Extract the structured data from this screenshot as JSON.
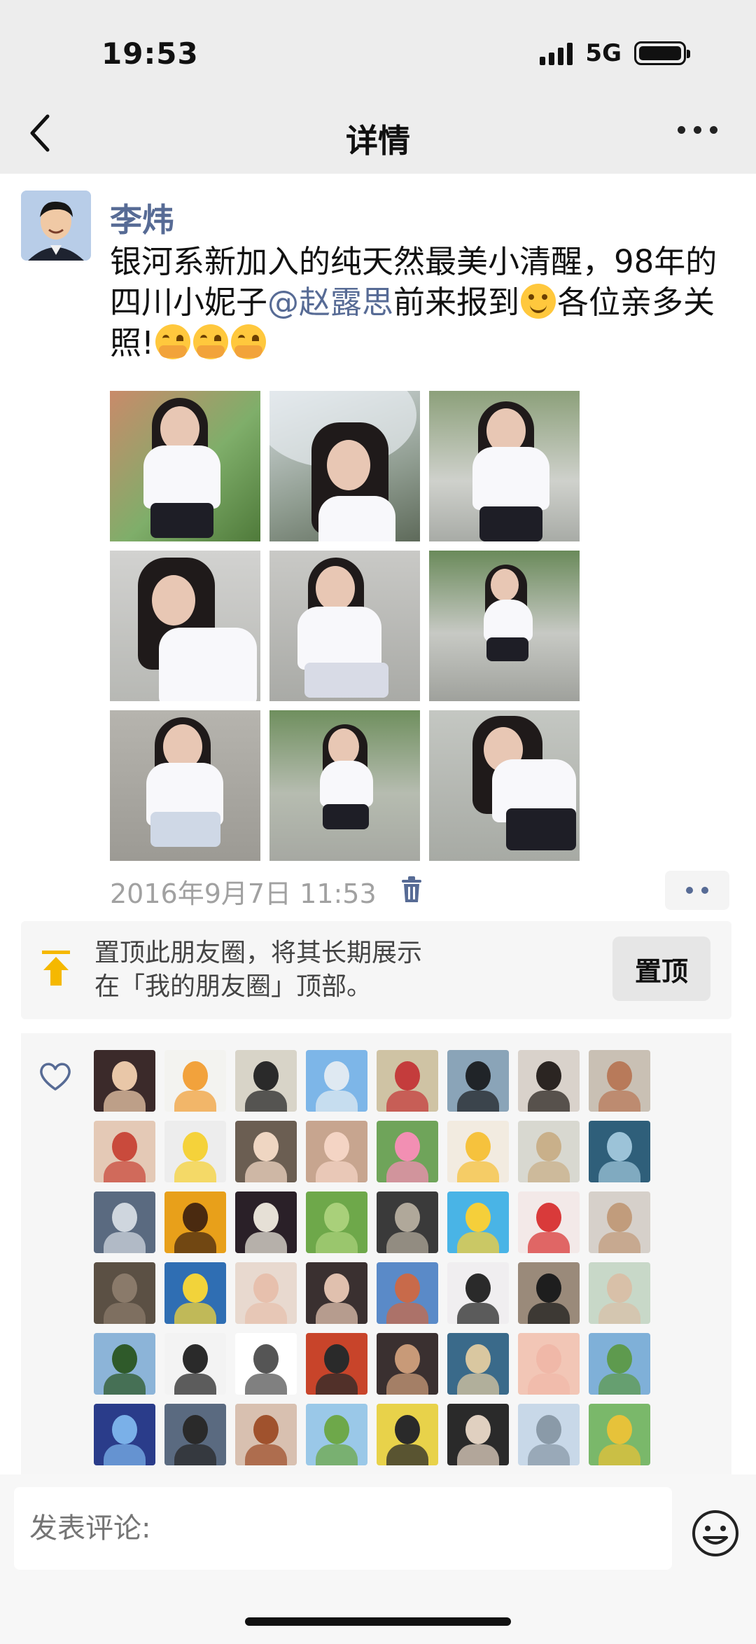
{
  "status_bar": {
    "time": "19:53",
    "network": "5G"
  },
  "nav": {
    "title": "详情"
  },
  "post": {
    "author": "李炜",
    "text_part1": "银河系新加入的纯天然最美小清醒，98年的四川小妮子",
    "mention": "@赵露思",
    "text_part2": "前来报到",
    "text_part3": "各位亲多关照!",
    "timestamp": "2016年9月7日 11:53",
    "photo_count": 9
  },
  "pin": {
    "text": "置顶此朋友圈，将其长期展示在「我的朋友圈」顶部。",
    "button_label": "置顶"
  },
  "likes": {
    "avatar_colors": [
      [
        "#3b2a2a",
        "#e9c7a8"
      ],
      [
        "#f3f3f0",
        "#f2a23c"
      ],
      [
        "#d8d4c8",
        "#2a2a2a"
      ],
      [
        "#7db6e8",
        "#dfe9f2"
      ],
      [
        "#cfc3a4",
        "#c43c3c"
      ],
      [
        "#8aa4b8",
        "#202428"
      ],
      [
        "#d9d2cb",
        "#2b2522"
      ],
      [
        "#c9c0b4",
        "#b87a5a"
      ],
      [
        "#e4c9b6",
        "#c94a3c"
      ],
      [
        "#ededed",
        "#f5d23a"
      ],
      [
        "#6b5e52",
        "#efd6c2"
      ],
      [
        "#c7a58f",
        "#f4d4c4"
      ],
      [
        "#6fa45a",
        "#f28fb3"
      ],
      [
        "#f2ebe0",
        "#f6c23d"
      ],
      [
        "#d8d8d0",
        "#c9b08a"
      ],
      [
        "#2f5f7a",
        "#9cc3d8"
      ],
      [
        "#5a6a80",
        "#cfd6de"
      ],
      [
        "#e8a01a",
        "#4a2a10"
      ],
      [
        "#2a2028",
        "#e6e0d6"
      ],
      [
        "#6ea84a",
        "#a9d07a"
      ],
      [
        "#3a3a3a",
        "#b0a89a"
      ],
      [
        "#49b4e6",
        "#f5cf3a"
      ],
      [
        "#f3e9e8",
        "#d93a3a"
      ],
      [
        "#d6d0ca",
        "#c19c7c"
      ],
      [
        "#5b5044",
        "#8a7a6a"
      ],
      [
        "#2f6eb3",
        "#f2d33a"
      ],
      [
        "#e8d9cf",
        "#e7c0ad"
      ],
      [
        "#3a3030",
        "#e0c0ae"
      ],
      [
        "#5a8ac8",
        "#c86a4a"
      ],
      [
        "#f0eef0",
        "#2a2a2a"
      ],
      [
        "#9a8a7a",
        "#1e1e1e"
      ],
      [
        "#c8d8c8",
        "#d8c0a8"
      ],
      [
        "#8cb4d8",
        "#2f5a2a"
      ],
      [
        "#f3f3f3",
        "#2a2a2a"
      ],
      [
        "#ffffff",
        "#555555"
      ],
      [
        "#c8442a",
        "#2a2a2a"
      ],
      [
        "#3a3030",
        "#c89a78"
      ],
      [
        "#3a6a8a",
        "#d9c7a0"
      ],
      [
        "#f2c6b6",
        "#f0b8a8"
      ],
      [
        "#7fb0d8",
        "#5e9a4e"
      ],
      [
        "#2a3c8a",
        "#7ab0e8"
      ],
      [
        "#5a6a80",
        "#2a2a2a"
      ],
      [
        "#d8c0b0",
        "#a0522d"
      ],
      [
        "#9ac8e8",
        "#6ea84a"
      ],
      [
        "#e8d24a",
        "#2a2a2a"
      ],
      [
        "#2a2a2a",
        "#e0d0c0"
      ],
      [
        "#c8d8e8",
        "#8a9aa8"
      ],
      [
        "#7ab86a",
        "#e6c23a"
      ]
    ]
  },
  "comment": {
    "placeholder": "发表评论:"
  }
}
